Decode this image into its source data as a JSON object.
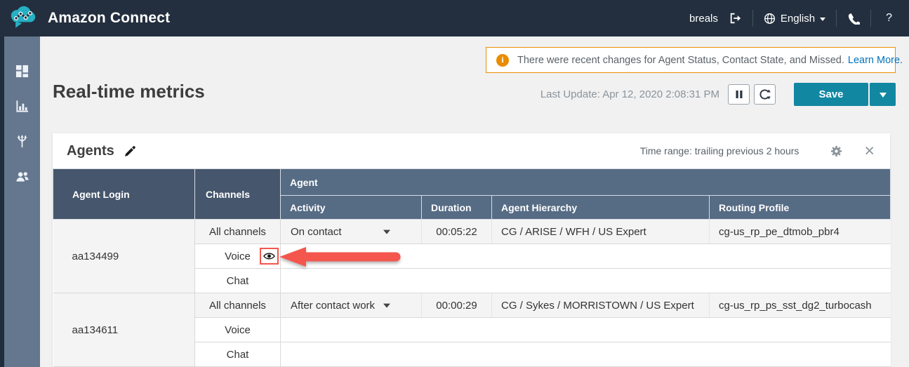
{
  "topbar": {
    "app_title": "Amazon Connect",
    "username": "breals",
    "language": "English",
    "help": "?"
  },
  "notification": {
    "message": "There were recent changes for Agent Status, Contact State, and Missed.",
    "link_label": "Learn More."
  },
  "page": {
    "title": "Real-time metrics",
    "last_update": "Last Update: Apr 12, 2020 2:08:31 PM",
    "save_label": "Save"
  },
  "panel": {
    "title": "Agents",
    "time_range": "Time range: trailing previous 2 hours"
  },
  "table": {
    "headers": {
      "agent_login": "Agent Login",
      "channels": "Channels",
      "agent_group": "Agent",
      "activity": "Activity",
      "duration": "Duration",
      "agent_hierarchy": "Agent Hierarchy",
      "routing_profile": "Routing Profile"
    },
    "rows": [
      {
        "agent_login": "aa134499",
        "subrows": [
          {
            "channel": "All channels",
            "activity": "On contact",
            "duration": "00:05:22",
            "agent_hierarchy": "CG / ARISE / WFH / US Expert",
            "routing_profile": "cg-us_rp_pe_dtmob_pbr4"
          },
          {
            "channel": "Voice"
          },
          {
            "channel": "Chat"
          }
        ]
      },
      {
        "agent_login": "aa134611",
        "subrows": [
          {
            "channel": "All channels",
            "activity": "After contact work",
            "duration": "00:00:29",
            "agent_hierarchy": "CG / Sykes / MORRISTOWN / US Expert",
            "routing_profile": "cg-us_rp_ps_sst_dg2_turbocash"
          },
          {
            "channel": "Voice"
          },
          {
            "channel": "Chat"
          }
        ]
      }
    ]
  },
  "icons": {
    "logo": "teal-cloud-network",
    "logout": "exit-arrow",
    "globe": "globe",
    "caret": "triangle-down",
    "phone": "handset",
    "nav": [
      "dashboard-grid",
      "metrics-bar-chart",
      "routing-split",
      "users"
    ],
    "pause": "pause-bars",
    "refresh": "circular-arrows",
    "edit": "pencil",
    "gear": "settings-gear",
    "close": "×",
    "eye": "visibility-eye",
    "annotation": "red-arrow-pointing-at-eye-toggle"
  },
  "colors": {
    "topbar_bg": "#232f3e",
    "sidebar_bg": "#64778f",
    "logo_teal": "#26b0c4",
    "accent_teal": "#1287a2",
    "notification_border": "#eb8f00",
    "link_blue": "#0073bb",
    "header_dark": "#46566c",
    "header_light": "#566b84",
    "annotation_red": "#f4564d",
    "row_gray": "#f4f4f4"
  }
}
